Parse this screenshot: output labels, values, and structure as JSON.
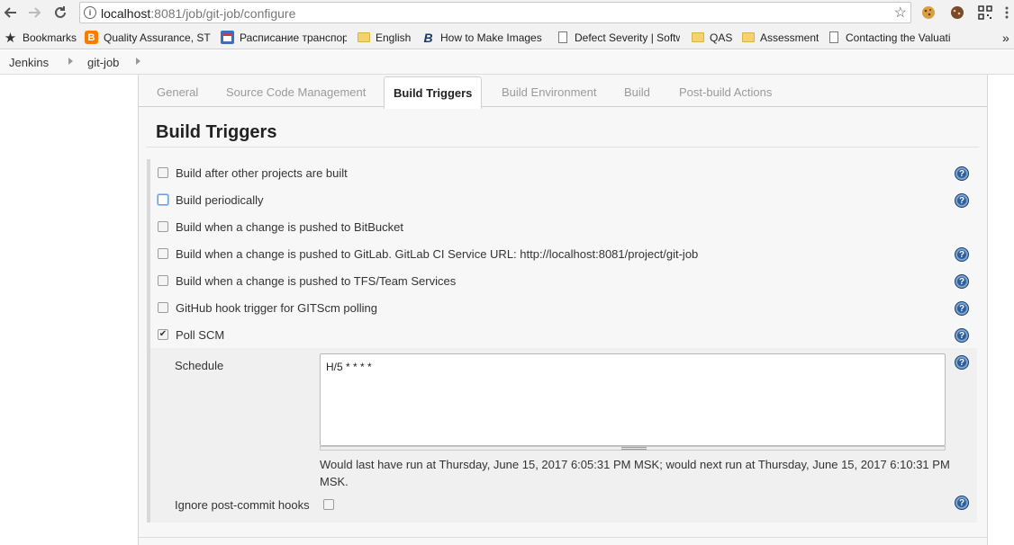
{
  "browser": {
    "url_host": "localhost",
    "url_rest": ":8081/job/git-job/configure",
    "bookmarks": [
      {
        "label": "Bookmarks",
        "icon": "star-icon"
      },
      {
        "label": "Quality Assurance, STL",
        "icon": "blogger-icon"
      },
      {
        "label": "Расписание транспорт",
        "icon": "schedule-icon"
      },
      {
        "label": "English",
        "icon": "folder-icon"
      },
      {
        "label": "How to Make Images",
        "icon": "b-logo-icon"
      },
      {
        "label": "Defect Severity | Softw",
        "icon": "page-icon"
      },
      {
        "label": "QAS",
        "icon": "folder-icon"
      },
      {
        "label": "Assessment",
        "icon": "folder-icon"
      },
      {
        "label": "Contacting the Valuati",
        "icon": "page-icon"
      }
    ],
    "overflow": "»"
  },
  "breadcrumb": [
    "Jenkins",
    "git-job"
  ],
  "tabs": [
    {
      "label": "General",
      "active": false
    },
    {
      "label": "Source Code Management",
      "active": false
    },
    {
      "label": "Build Triggers",
      "active": true
    },
    {
      "label": "Build Environment",
      "active": false
    },
    {
      "label": "Build",
      "active": false
    },
    {
      "label": "Post-build Actions",
      "active": false
    }
  ],
  "section": {
    "title": "Build Triggers",
    "triggers": [
      {
        "label": "Build after other projects are built",
        "checked": false,
        "help": true
      },
      {
        "label": "Build periodically",
        "checked": false,
        "help": true
      },
      {
        "label": "Build when a change is pushed to BitBucket",
        "checked": false,
        "help": false
      },
      {
        "label": "Build when a change is pushed to GitLab. GitLab CI Service URL: http://localhost:8081/project/git-job",
        "checked": false,
        "help": true
      },
      {
        "label": "Build when a change is pushed to TFS/Team Services",
        "checked": false,
        "help": true
      },
      {
        "label": "GitHub hook trigger for GITScm polling",
        "checked": false,
        "help": true
      },
      {
        "label": "Poll SCM",
        "checked": true,
        "help": true
      }
    ],
    "schedule_label": "Schedule",
    "schedule_value": "H/5 * * * *",
    "run_info": "Would last have run at Thursday, June 15, 2017 6:05:31 PM MSK; would next run at Thursday, June 15, 2017 6:10:31 PM MSK.",
    "ignore_label": "Ignore post-commit hooks",
    "ignore_checked": false
  }
}
